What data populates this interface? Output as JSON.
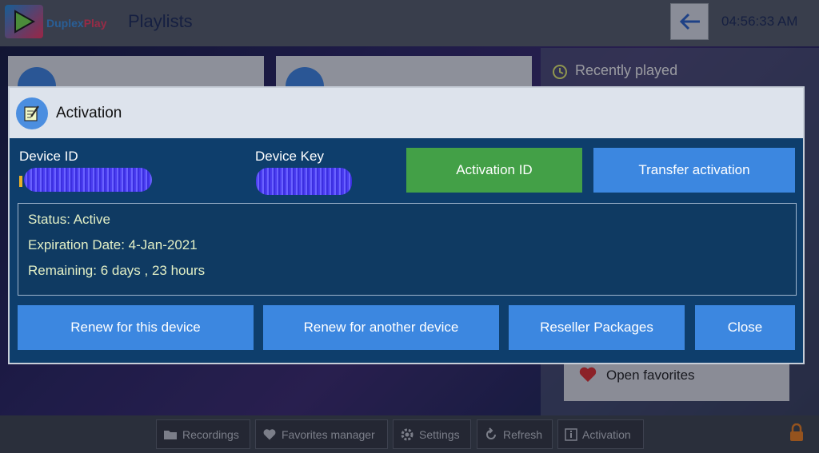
{
  "app": {
    "brand_part1": "Duplex",
    "brand_part2": "Play",
    "page_title": "Playlists",
    "clock": "04:56:33 AM"
  },
  "background": {
    "recently_played": "Recently played",
    "open_favorites": "Open favorites"
  },
  "toolbar": {
    "items": [
      {
        "label": "Recordings",
        "icon": "folder-icon"
      },
      {
        "label": "Favorites manager",
        "icon": "heart-icon"
      },
      {
        "label": "Settings",
        "icon": "gear-icon"
      },
      {
        "label": "Refresh",
        "icon": "refresh-icon"
      },
      {
        "label": "Activation",
        "icon": "info-icon"
      }
    ]
  },
  "dialog": {
    "title": "Activation",
    "device_id_label": "Device ID",
    "device_key_label": "Device Key",
    "activation_id_button": "Activation ID",
    "transfer_button": "Transfer activation",
    "status": "Status: Active",
    "expiration": "Expiration Date: 4-Jan-2021",
    "remaining": "Remaining: 6 days , 23 hours",
    "renew_this": "Renew for this device",
    "renew_another": "Renew for another device",
    "reseller": "Reseller Packages",
    "close": "Close"
  },
  "colors": {
    "accent_blue": "#3c87e0",
    "accent_green": "#43a047",
    "dialog_bg": "#0e3e6c"
  }
}
